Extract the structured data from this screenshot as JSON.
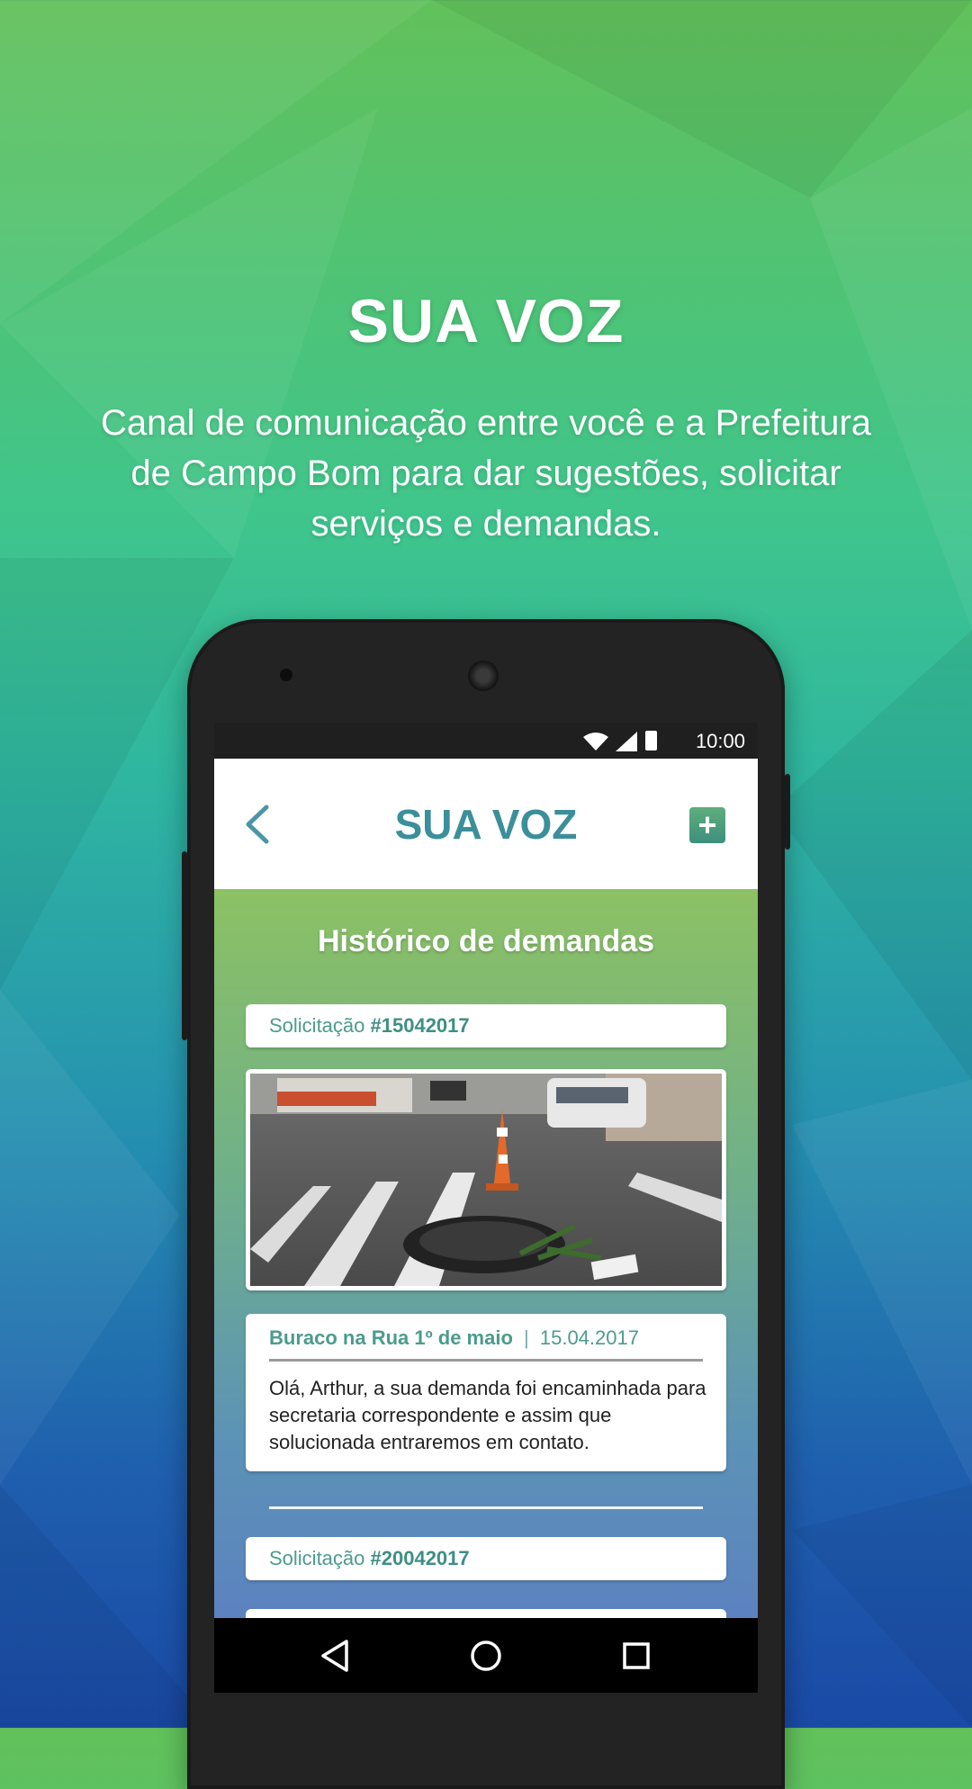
{
  "hero": {
    "title": "SUA VOZ",
    "description": "Canal de comunicação entre você e a Prefeitura de Campo Bom para dar sugestões, solicitar serviços e demandas."
  },
  "status_bar": {
    "time": "10:00"
  },
  "app_bar": {
    "title": "SUA VOZ",
    "add_label": "+"
  },
  "content": {
    "section_title": "Histórico de demandas",
    "requests": [
      {
        "label": "Solicitação",
        "number": "#15042017",
        "subject": "Buraco na Rua 1º de maio",
        "separator": "|",
        "date": "15.04.2017",
        "message": "Olá, Arthur, a sua demanda foi encaminhada para secretaria correspondente e assim que solucionada entraremos em contato."
      },
      {
        "label": "Solicitação",
        "number": "#20042017"
      }
    ]
  },
  "colors": {
    "accent": "#3b8f9a",
    "text_green": "#4b9c8c"
  }
}
